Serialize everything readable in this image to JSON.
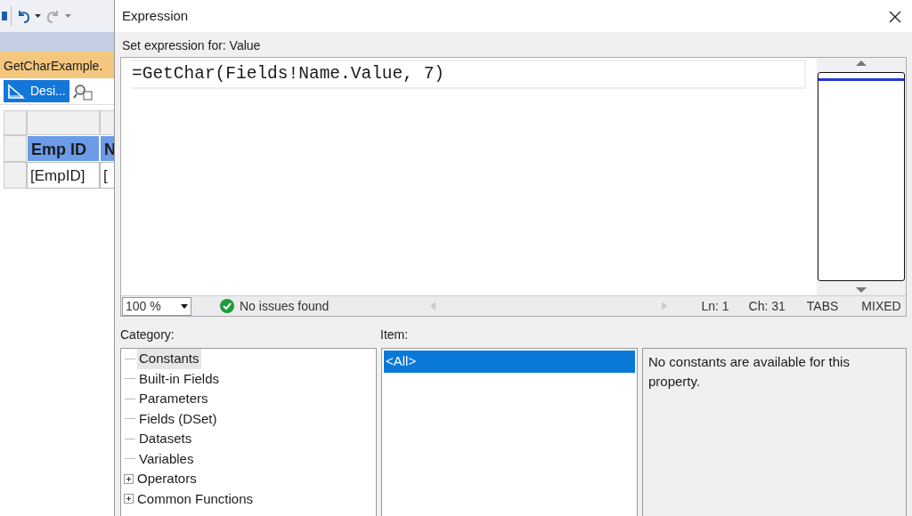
{
  "background_window": {
    "toolbar": {
      "undo_enabled": true,
      "redo_enabled": false
    },
    "document_tab": {
      "label": "GetCharExample."
    },
    "design_button": {
      "label": "Desi...",
      "selected": true
    },
    "table": {
      "columns": [
        "Emp ID",
        "N"
      ],
      "rows": [
        [
          "[EmpID]",
          "["
        ]
      ]
    }
  },
  "dialog": {
    "title": "Expression",
    "prompt": "Set expression for: Value",
    "expression": "=GetChar(Fields!Name.Value, 7)",
    "status_bar": {
      "zoom": "100 %",
      "issues": "No issues found",
      "line": "Ln: 1",
      "column": "Ch: 31",
      "tabs": "TABS",
      "mode": "MIXED"
    },
    "category_label": "Category:",
    "categories": [
      {
        "label": "Constants",
        "selected": true,
        "kind": "leaf"
      },
      {
        "label": "Built-in Fields",
        "selected": false,
        "kind": "leaf"
      },
      {
        "label": "Parameters",
        "selected": false,
        "kind": "leaf"
      },
      {
        "label": "Fields (DSet)",
        "selected": false,
        "kind": "leaf"
      },
      {
        "label": "Datasets",
        "selected": false,
        "kind": "leaf"
      },
      {
        "label": "Variables",
        "selected": false,
        "kind": "leaf"
      },
      {
        "label": "Operators",
        "selected": false,
        "kind": "group"
      },
      {
        "label": "Common Functions",
        "selected": false,
        "kind": "group"
      }
    ],
    "item_label": "Item:",
    "items": [
      {
        "label": "<All>",
        "selected": true
      }
    ],
    "description": "No constants are available for this property."
  }
}
